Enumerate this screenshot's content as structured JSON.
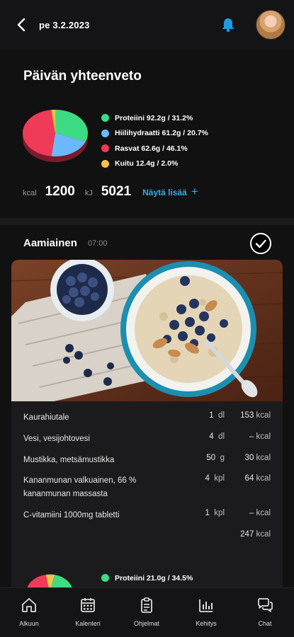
{
  "header": {
    "date": "pe 3.2.2023"
  },
  "summary": {
    "title": "Päivän yhteenveto",
    "legend": [
      {
        "label": "Proteiini 92.2g / 31.2%",
        "color": "#3ddc84",
        "percent": 31.2
      },
      {
        "label": "Hiilihydraatti 61.2g / 20.7%",
        "color": "#6cb8ff",
        "percent": 20.7
      },
      {
        "label": "Rasvat 62.6g / 46.1%",
        "color": "#ef3b58",
        "percent": 46.1
      },
      {
        "label": "Kuitu 12.4g / 2.0%",
        "color": "#f4c247",
        "percent": 2.0
      }
    ],
    "kcal_unit": "kcal",
    "kcal_value": "1200",
    "kj_unit": "kJ",
    "kj_value": "5021",
    "more_label": "Näytä lisää",
    "more_icon": "+"
  },
  "meal": {
    "title": "Aamiainen",
    "time": "07:00",
    "foods": [
      {
        "name": "Kaurahiutale",
        "amount": "1",
        "unit": "dl",
        "kcal": "153",
        "kcal_unit": "kcal"
      },
      {
        "name": "Vesi, vesijohtovesi",
        "amount": "4",
        "unit": "dl",
        "kcal": "–",
        "kcal_unit": "kcal"
      },
      {
        "name": "Mustikka, metsämustikka",
        "amount": "50",
        "unit": "g",
        "kcal": "30",
        "kcal_unit": "kcal"
      },
      {
        "name": "Kananmunan valkuainen, 66 % kananmunan massasta",
        "amount": "4",
        "unit": "kpl",
        "kcal": "64",
        "kcal_unit": "kcal"
      },
      {
        "name": "C-vitamiini 1000mg tabletti",
        "amount": "1",
        "unit": "kpl",
        "kcal": "–",
        "kcal_unit": "kcal"
      }
    ],
    "total_kcal": "247",
    "total_unit": "kcal",
    "legend_preview": "Proteiini 21.0g / 34.5%",
    "legend_preview_color": "#3ddc84"
  },
  "nav": [
    {
      "label": "Alkuun",
      "icon": "home-icon"
    },
    {
      "label": "Kalenteri",
      "icon": "calendar-icon"
    },
    {
      "label": "Ohjelmat",
      "icon": "clipboard-icon"
    },
    {
      "label": "Kehitys",
      "icon": "bar-chart-icon"
    },
    {
      "label": "Chat",
      "icon": "chat-icon"
    }
  ]
}
